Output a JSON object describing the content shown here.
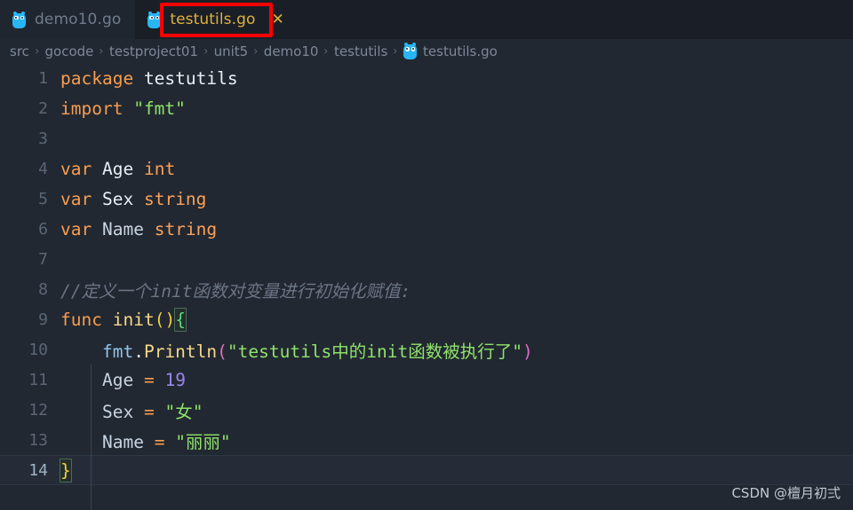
{
  "tabs": [
    {
      "label": "demo10.go",
      "icon": "go-gopher-icon",
      "active": false,
      "closable": false
    },
    {
      "label": "testutils.go",
      "icon": "go-gopher-icon",
      "active": true,
      "closable": true,
      "close_glyph": "✕"
    }
  ],
  "annotation": {
    "type": "rectangle-highlight",
    "color": "#fe0000",
    "target": "testutils.go tab"
  },
  "breadcrumb": {
    "separator": "›",
    "items": [
      "src",
      "gocode",
      "testproject01",
      "unit5",
      "demo10",
      "testutils"
    ],
    "file": {
      "label": "testutils.go",
      "icon": "go-gopher-icon"
    }
  },
  "editor": {
    "language": "go",
    "current_line": 14,
    "lines": [
      {
        "no": "1",
        "tokens": [
          {
            "t": "package",
            "c": "kw"
          },
          {
            "t": " ",
            "c": "plain"
          },
          {
            "t": "testutils",
            "c": "white"
          }
        ]
      },
      {
        "no": "2",
        "tokens": [
          {
            "t": "import",
            "c": "kw"
          },
          {
            "t": " ",
            "c": "plain"
          },
          {
            "t": "\"fmt\"",
            "c": "str"
          }
        ]
      },
      {
        "no": "3",
        "tokens": []
      },
      {
        "no": "4",
        "tokens": [
          {
            "t": "var",
            "c": "kw"
          },
          {
            "t": " ",
            "c": "plain"
          },
          {
            "t": "Age",
            "c": "white"
          },
          {
            "t": " ",
            "c": "plain"
          },
          {
            "t": "int",
            "c": "type"
          }
        ]
      },
      {
        "no": "5",
        "tokens": [
          {
            "t": "var",
            "c": "kw"
          },
          {
            "t": " ",
            "c": "plain"
          },
          {
            "t": "Sex",
            "c": "white"
          },
          {
            "t": " ",
            "c": "plain"
          },
          {
            "t": "string",
            "c": "type"
          }
        ]
      },
      {
        "no": "6",
        "tokens": [
          {
            "t": "var",
            "c": "kw"
          },
          {
            "t": " ",
            "c": "plain"
          },
          {
            "t": "Name",
            "c": "var"
          },
          {
            "t": " ",
            "c": "plain"
          },
          {
            "t": "string",
            "c": "type"
          }
        ]
      },
      {
        "no": "7",
        "tokens": []
      },
      {
        "no": "8",
        "tokens": [
          {
            "t": "//定义一个init函数对变量进行初始化赋值:",
            "c": "cmt"
          }
        ]
      },
      {
        "no": "9",
        "tokens": [
          {
            "t": "func",
            "c": "kw"
          },
          {
            "t": " ",
            "c": "plain"
          },
          {
            "t": "init",
            "c": "fn"
          },
          {
            "t": "(",
            "c": "pareny"
          },
          {
            "t": ")",
            "c": "pareny"
          },
          {
            "t": "{",
            "c": "braceg",
            "match": true
          }
        ]
      },
      {
        "no": "10",
        "tokens": [
          {
            "t": "    ",
            "c": "plain"
          },
          {
            "t": "fmt",
            "c": "pkg"
          },
          {
            "t": ".",
            "c": "white"
          },
          {
            "t": "Println",
            "c": "fn"
          },
          {
            "t": "(",
            "c": "parenp"
          },
          {
            "t": "\"testutils中的init函数被执行了\"",
            "c": "str"
          },
          {
            "t": ")",
            "c": "parenp"
          }
        ]
      },
      {
        "no": "11",
        "tokens": [
          {
            "t": "    ",
            "c": "plain"
          },
          {
            "t": "Age",
            "c": "var"
          },
          {
            "t": " ",
            "c": "plain"
          },
          {
            "t": "=",
            "c": "op"
          },
          {
            "t": " ",
            "c": "plain"
          },
          {
            "t": "19",
            "c": "num"
          }
        ]
      },
      {
        "no": "12",
        "tokens": [
          {
            "t": "    ",
            "c": "plain"
          },
          {
            "t": "Sex",
            "c": "var"
          },
          {
            "t": " ",
            "c": "plain"
          },
          {
            "t": "=",
            "c": "op"
          },
          {
            "t": " ",
            "c": "plain"
          },
          {
            "t": "\"女\"",
            "c": "str"
          }
        ]
      },
      {
        "no": "13",
        "tokens": [
          {
            "t": "    ",
            "c": "plain"
          },
          {
            "t": "Name",
            "c": "var"
          },
          {
            "t": " ",
            "c": "plain"
          },
          {
            "t": "=",
            "c": "op"
          },
          {
            "t": " ",
            "c": "plain"
          },
          {
            "t": "\"丽丽\"",
            "c": "str"
          }
        ]
      },
      {
        "no": "14",
        "tokens": [
          {
            "t": "}",
            "c": "bracey",
            "match": true
          }
        ]
      }
    ]
  },
  "watermark": "CSDN @檀月初弍",
  "colors": {
    "tabbar_bg": "#1a1f27",
    "editor_bg": "#222831",
    "annotation_red": "#fe0000",
    "active_tab_text": "#dfb13c",
    "keyword": "#f69d50",
    "string": "#8fe36b",
    "comment": "#6b7585",
    "number": "#9a86f0"
  }
}
